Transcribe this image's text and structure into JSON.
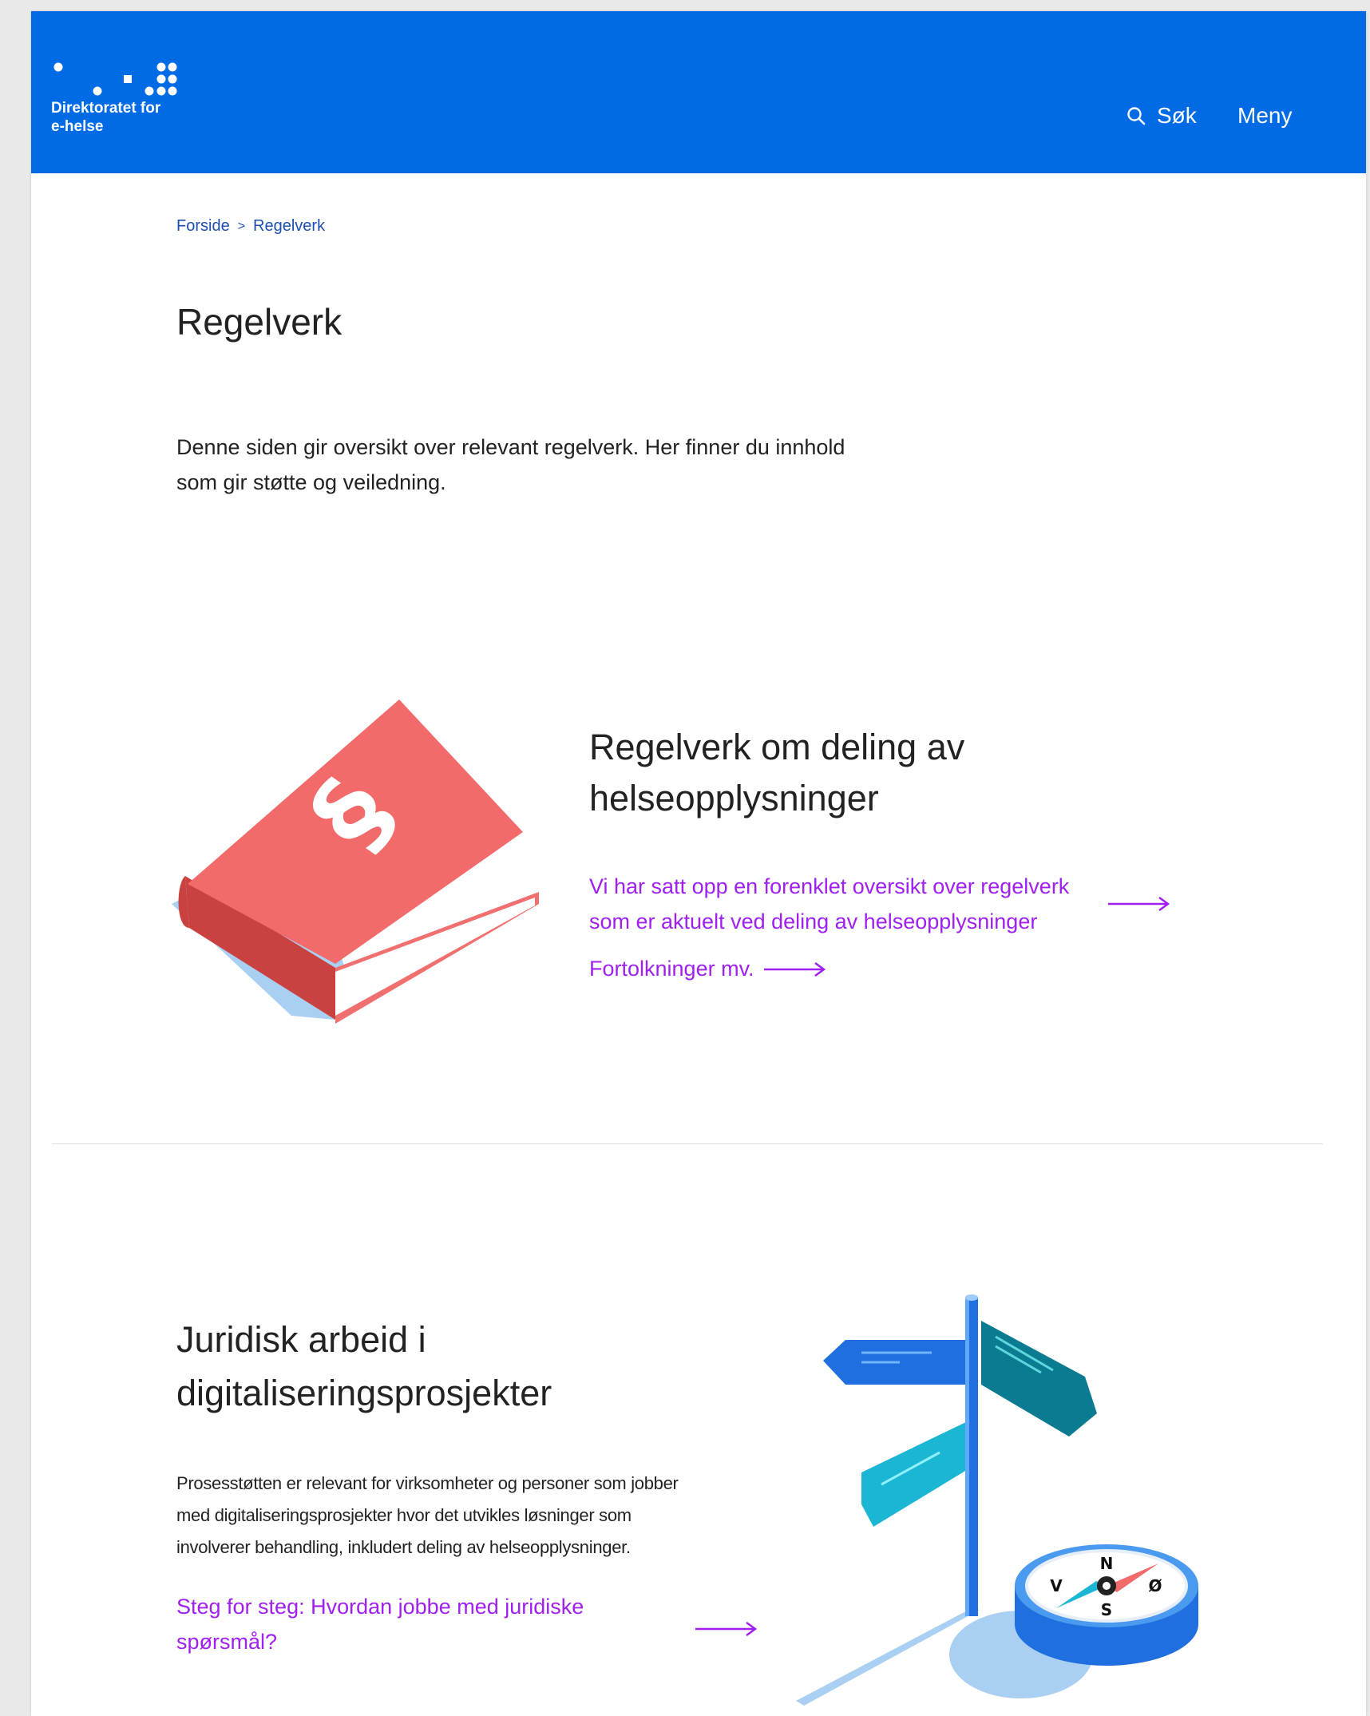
{
  "header": {
    "logo_line1": "Direktoratet for",
    "logo_line2": "e-helse",
    "search_label": "Søk",
    "menu_label": "Meny"
  },
  "breadcrumb": {
    "home": "Forside",
    "separator": ">",
    "current": "Regelverk"
  },
  "page": {
    "title": "Regelverk",
    "intro_line1": "Denne siden gir oversikt over relevant regelverk. Her finner du innhold",
    "intro_line2": "som gir støtte og veiledning."
  },
  "section1": {
    "title_line1": "Regelverk om deling av",
    "title_line2": "helseopplysninger",
    "link1_line1": "Vi har satt opp en forenklet oversikt over regelverk",
    "link1_line2": "som er aktuelt ved deling av helseopplysninger",
    "link2": "Fortolkninger mv.",
    "book_symbol": "§"
  },
  "section2": {
    "title_line1": "Juridisk arbeid i",
    "title_line2": "digitaliseringsprosjekter",
    "body_line1": "Prosesstøtten er relevant for virksomheter og personer som jobber",
    "body_line2": "med digitaliseringsprosjekter hvor det utvikles løsninger som",
    "body_line3": "involverer behandling, inkludert deling av helseopplysninger.",
    "link_line1": "Steg for steg: Hvordan jobbe med juridiske",
    "link_line2": "spørsmål?",
    "compass": {
      "n": "N",
      "s": "S",
      "e": "Ø",
      "w": "V"
    }
  },
  "colors": {
    "brand_blue": "#006be5",
    "link_purple": "#a020f0",
    "book_red": "#f26a6a",
    "book_shadow": "#a9cff2"
  },
  "icons": [
    "logo-dots-icon",
    "search-icon",
    "arrow-right-icon",
    "book-illustration",
    "signpost-compass-illustration"
  ]
}
